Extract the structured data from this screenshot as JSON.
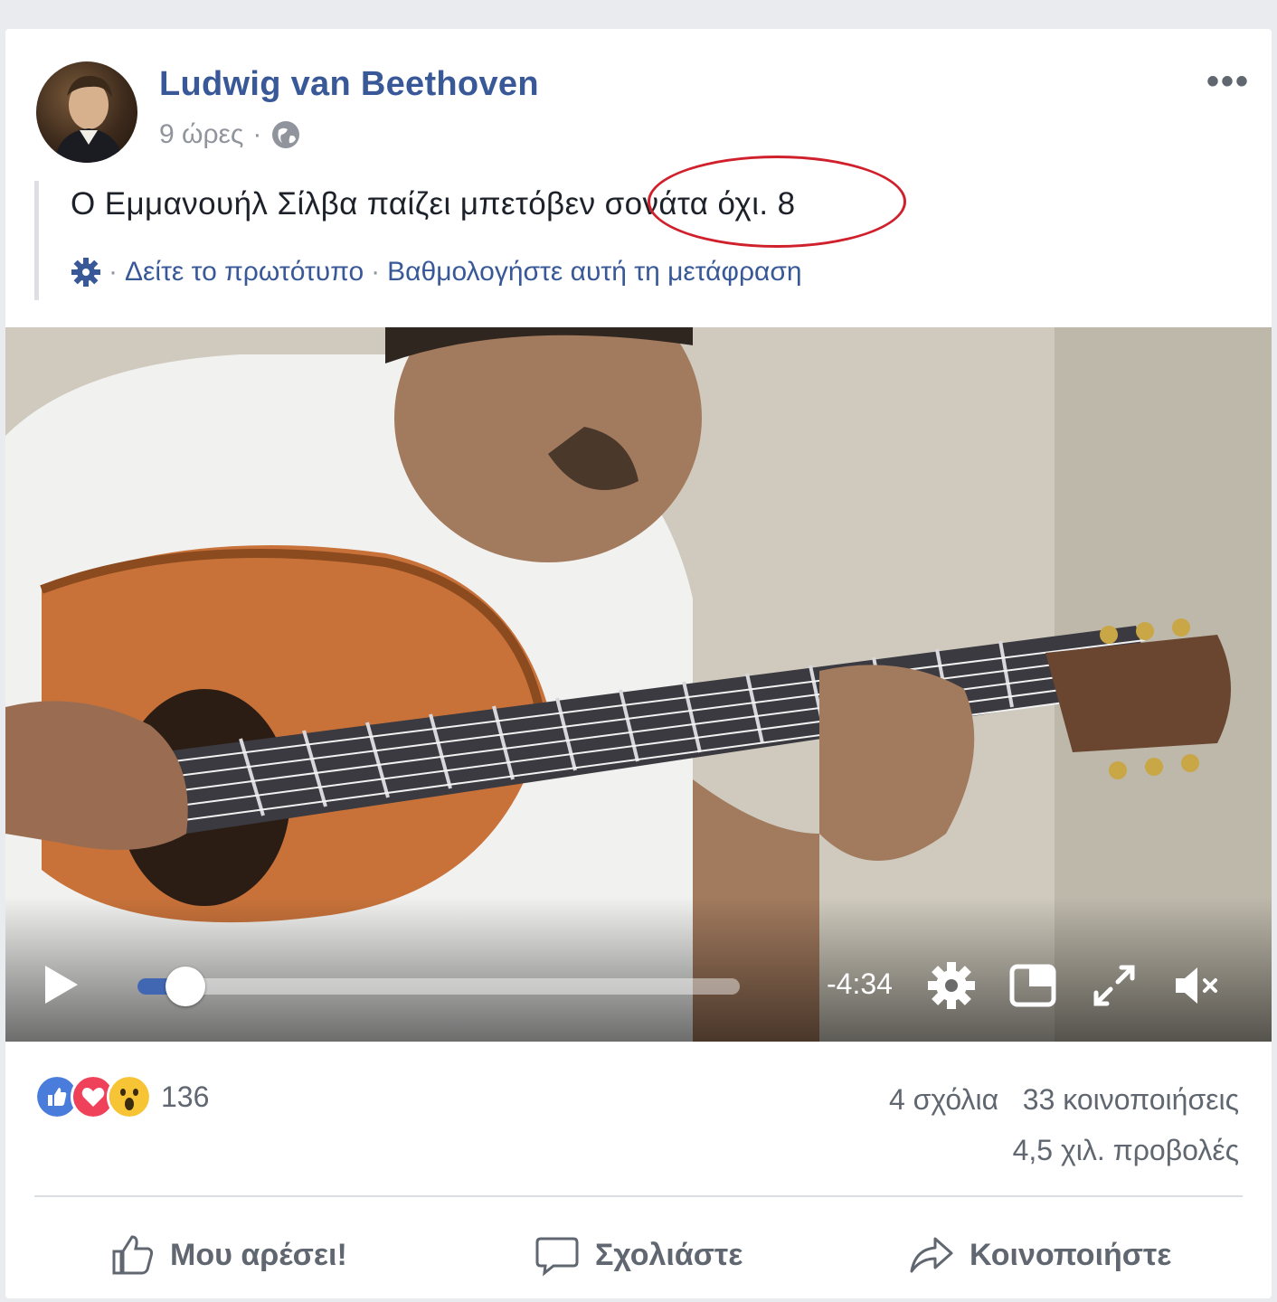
{
  "post": {
    "author": "Ludwig van Beethoven",
    "time": "9 ώρες",
    "meta_sep": "·",
    "text": "Ο Εμμανουήλ Σίλβα παίζει μπετόβεν σονάτα όχι. 8",
    "translation": {
      "sep": "·",
      "see_original": "Δείτε το πρωτότυπο",
      "rate": "Βαθμολογήστε αυτή τη μετάφραση"
    },
    "more_label": "•••"
  },
  "video": {
    "time_remaining": "-4:34",
    "progress_fraction": 0.08
  },
  "engagement": {
    "reaction_count": "136",
    "comments": "4 σχόλια",
    "shares": "33 κοινοποιήσεις",
    "views": "4,5 χιλ. προβολές"
  },
  "actions": {
    "like": "Μου αρέσει!",
    "comment": "Σχολιάστε",
    "share": "Κοινοποιήστε"
  },
  "icons": [
    "globe-icon",
    "gear-icon",
    "play-icon",
    "settings-icon",
    "picture-in-picture-icon",
    "fullscreen-icon",
    "mute-icon",
    "like-icon",
    "comment-icon",
    "share-icon"
  ],
  "colors": {
    "link": "#385898",
    "accent": "#4267b2",
    "highlight": "#d0202b",
    "muted": "#606770"
  }
}
